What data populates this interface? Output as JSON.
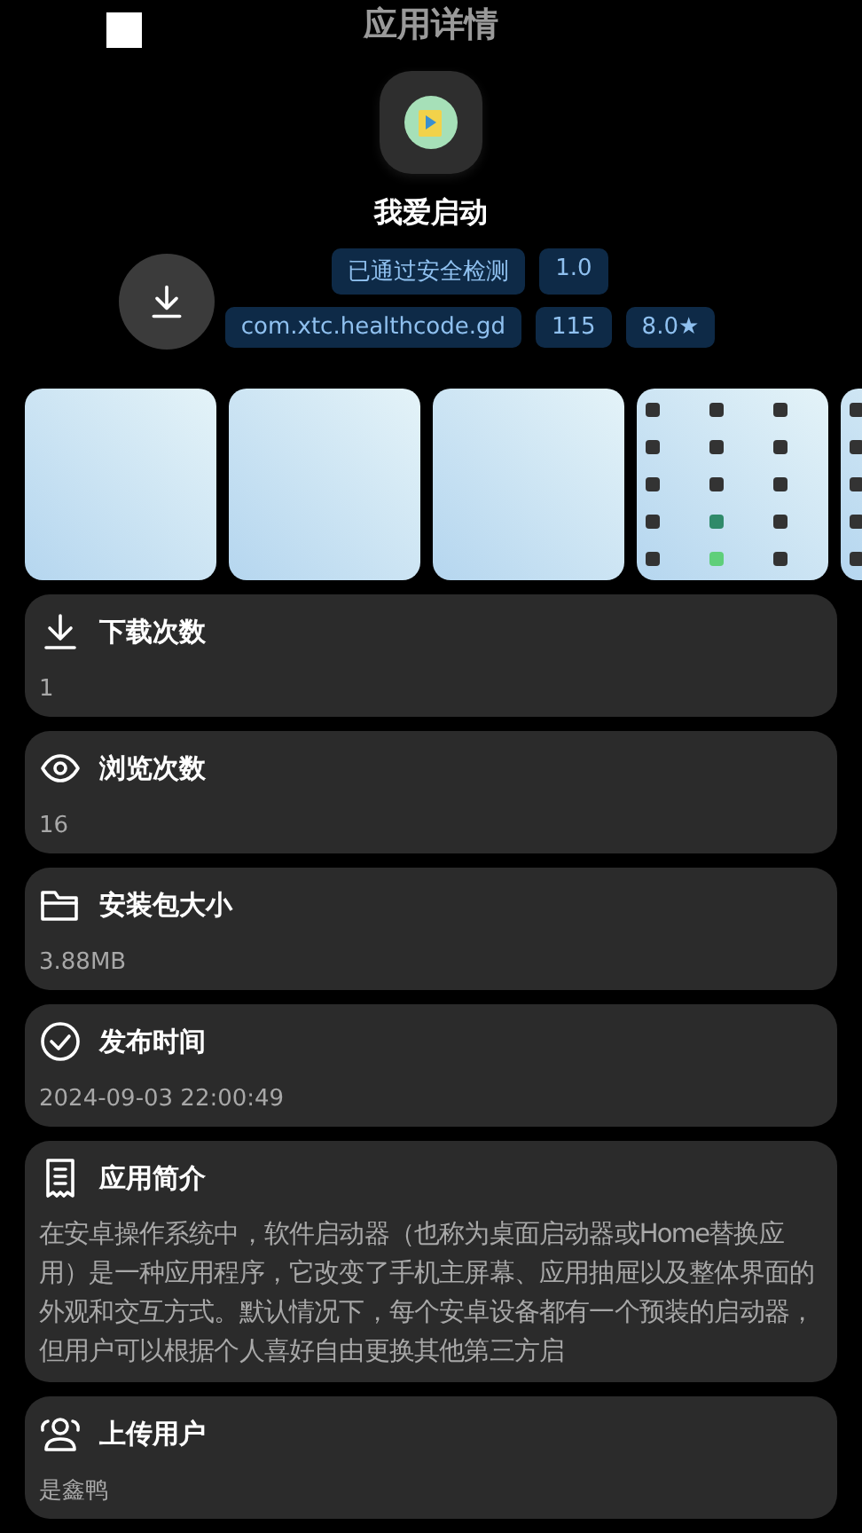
{
  "header": {
    "title": "应用详情"
  },
  "app": {
    "name": "我爱启动",
    "tag_rows": [
      [
        "已通过安全检测",
        "1.0"
      ],
      [
        "com.xtc.healthcode.gd",
        "115",
        "8.0★"
      ]
    ]
  },
  "info_cards": [
    {
      "kind": "downloads",
      "label": "下载次数",
      "value": "1"
    },
    {
      "kind": "views",
      "label": "浏览次数",
      "value": "16"
    },
    {
      "kind": "size",
      "label": "安装包大小",
      "value": "3.88MB"
    },
    {
      "kind": "date",
      "label": "发布时间",
      "value": "2024-09-03 22:00:49"
    },
    {
      "kind": "description",
      "label": "应用简介",
      "value": "在安卓操作系统中，软件启动器（也称为桌面启动器或Home替换应用）是一种应用程序，它改变了手机主屏幕、应用抽屉以及整体界面的外观和交互方式。默认情况下，每个安卓设备都有一个预装的启动器，但用户可以根据个人喜好自由更换其他第三方启"
    },
    {
      "kind": "uploader",
      "label": "上传用户",
      "value": "是鑫鸭"
    }
  ]
}
